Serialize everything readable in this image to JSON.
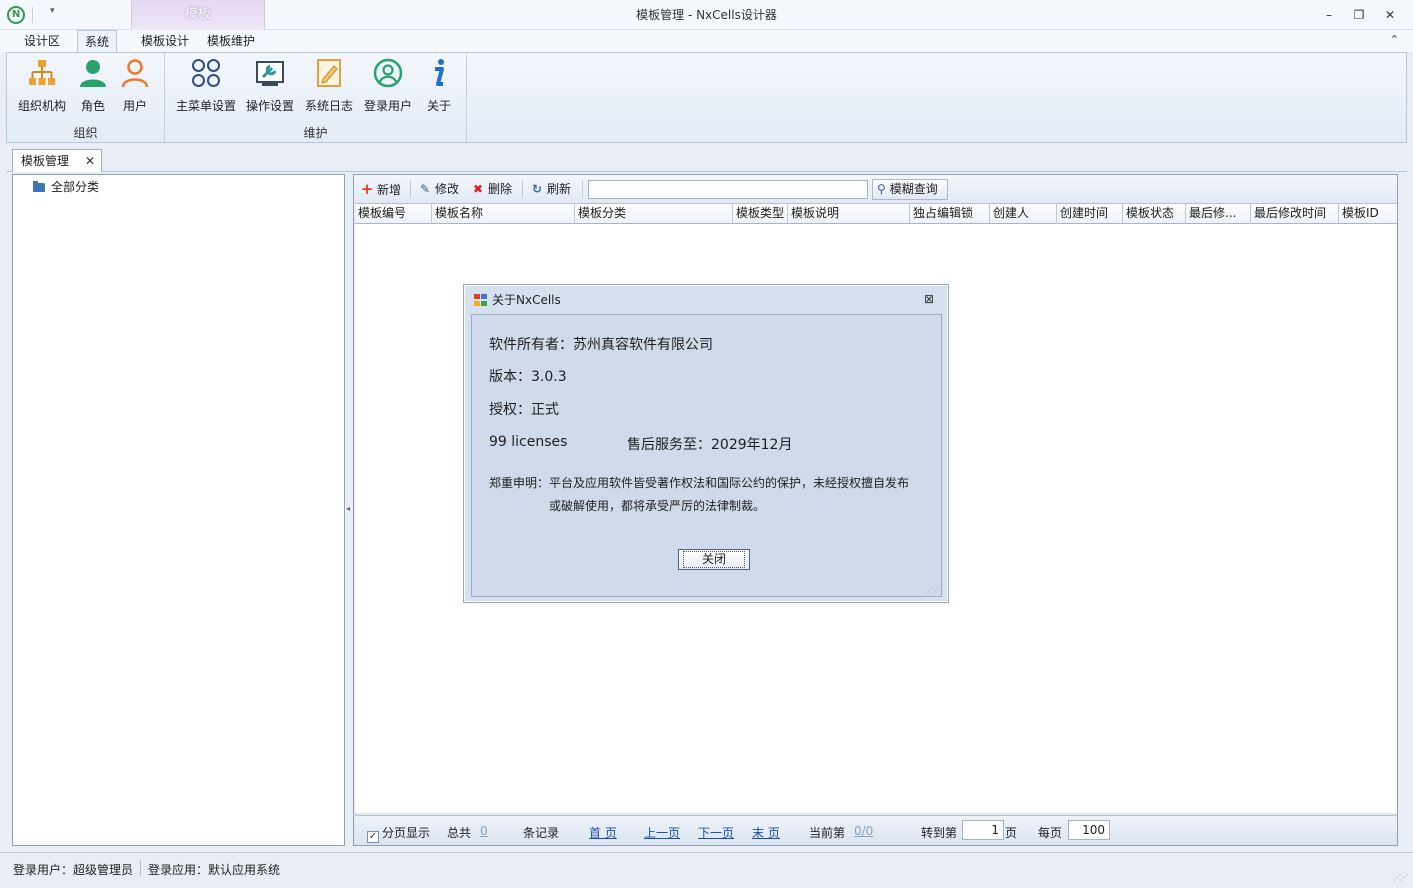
{
  "window": {
    "title": "模板管理 - NxCells设计器",
    "context_tab": "模板",
    "minimize": "–",
    "restore": "❐",
    "close": "✕"
  },
  "ribbon": {
    "tabs": [
      {
        "label": "设计区",
        "active": false
      },
      {
        "label": "系统",
        "active": true
      },
      {
        "label": "模板设计",
        "active": false
      },
      {
        "label": "模板维护",
        "active": false
      }
    ],
    "groups": [
      {
        "label": "组织",
        "buttons": [
          {
            "label": "组织机构",
            "icon": "org-chart-icon"
          },
          {
            "label": "角色",
            "icon": "role-icon"
          },
          {
            "label": "用户",
            "icon": "user-icon"
          }
        ]
      },
      {
        "label": "维护",
        "buttons": [
          {
            "label": "主菜单设置",
            "icon": "menu-settings-icon"
          },
          {
            "label": "操作设置",
            "icon": "operation-settings-icon"
          },
          {
            "label": "系统日志",
            "icon": "system-log-icon"
          },
          {
            "label": "登录用户",
            "icon": "logged-in-user-icon"
          },
          {
            "label": "关于",
            "icon": "info-icon"
          }
        ]
      }
    ]
  },
  "doc_tab": {
    "label": "模板管理",
    "close": "✕"
  },
  "tree": {
    "root": "全部分类"
  },
  "toolbar": {
    "add": "新增",
    "edit": "修改",
    "delete": "删除",
    "refresh": "刷新",
    "search_value": "",
    "fuzzy_search": "模糊查询"
  },
  "grid": {
    "columns": [
      "模板编号",
      "模板名称",
      "模板分类",
      "模板类型",
      "模板说明",
      "独占编辑锁",
      "创建人",
      "创建时间",
      "模板状态",
      "最后修...",
      "最后修改时间",
      "模板ID"
    ]
  },
  "pager": {
    "paging_label": "分页显示",
    "paging_checked": true,
    "total_label": "总共",
    "total_value": "0",
    "records_label": "条记录",
    "first": "首 页",
    "prev": "上一页",
    "next": "下一页",
    "last": "末 页",
    "current_label": "当前第",
    "current_value": "0/0",
    "goto_label": "转到第",
    "goto_value": "1",
    "page_suffix": "页",
    "per_page_label": "每页",
    "per_page_value": "100"
  },
  "status": {
    "user": "登录用户：超级管理员",
    "app": "登录应用：默认应用系统"
  },
  "dialog": {
    "title": "关于NxCells",
    "owner": "软件所有者：苏州真容软件有限公司",
    "version": "版本：3.0.3",
    "license": "授权：正式",
    "licenses": "99 licenses",
    "service": "售后服务至：2029年12月",
    "notice_line1": "郑重申明：平台及应用软件皆受著作权法和国际公约的保护，未经授权擅自发布",
    "notice_line2": "或破解使用，都将承受严厉的法律制裁。",
    "close_button": "关闭"
  },
  "colors": {
    "accent": "#1b4fa8",
    "ribbon_bg": "#e3ebf6",
    "dialog_bg": "#cfdbeb",
    "context_tab": "#e5d7f5"
  }
}
